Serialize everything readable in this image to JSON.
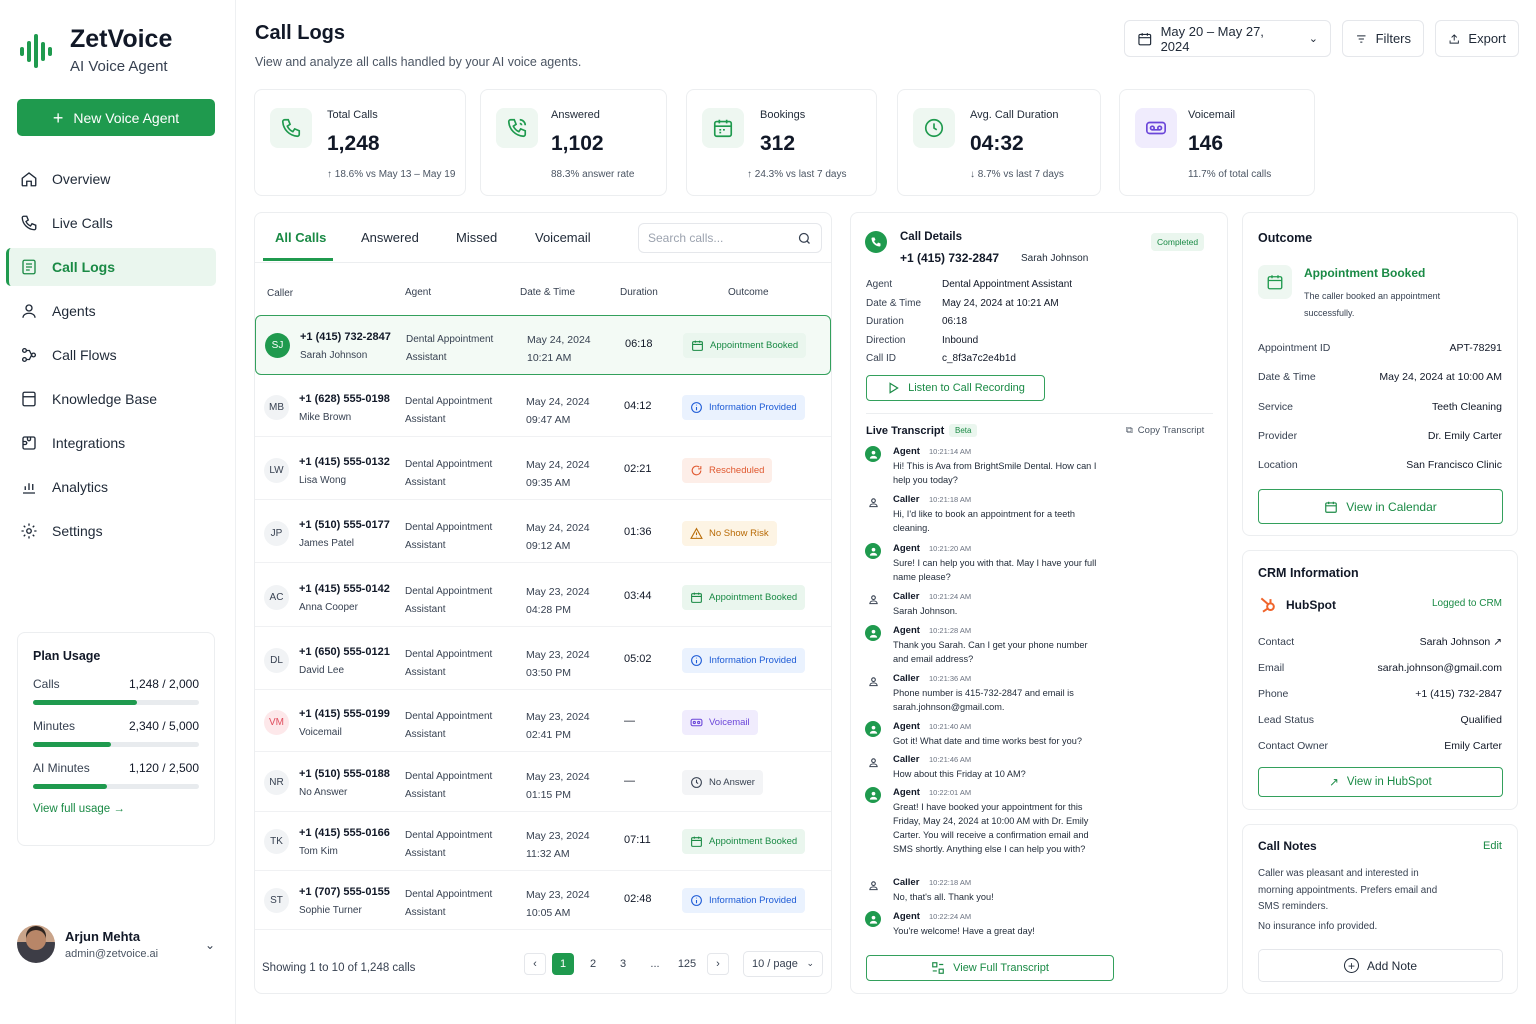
{
  "brand": {
    "name": "ZetVoice",
    "tagline": "AI Voice Agent"
  },
  "sidebar": {
    "new_agent_label": "New Voice Agent",
    "items": [
      {
        "label": "Overview",
        "icon": "home-icon"
      },
      {
        "label": "Live Calls",
        "icon": "phone-icon"
      },
      {
        "label": "Call Logs",
        "icon": "call-log-icon",
        "active": true
      },
      {
        "label": "Agents",
        "icon": "users-icon"
      },
      {
        "label": "Call Flows",
        "icon": "flow-icon"
      },
      {
        "label": "Knowledge Base",
        "icon": "book-icon"
      },
      {
        "label": "Integrations",
        "icon": "puzzle-icon"
      },
      {
        "label": "Analytics",
        "icon": "chart-icon"
      },
      {
        "label": "Settings",
        "icon": "gear-icon"
      }
    ],
    "plan": {
      "title": "Plan Usage",
      "rows": [
        {
          "label": "Calls",
          "value": "1,248 / 2,000",
          "fraction": 0.624
        },
        {
          "label": "Minutes",
          "value": "2,340 / 5,000",
          "fraction": 0.468
        },
        {
          "label": "AI Minutes",
          "value": "1,120 / 2,500",
          "fraction": 0.448
        }
      ],
      "link": "View full usage"
    },
    "user": {
      "name": "Arjun Mehta",
      "email": "admin@zetvoice.ai"
    }
  },
  "header": {
    "title": "Call Logs",
    "subtitle": "View and analyze all calls handled by your AI voice agents.",
    "date_range": "May 20 – May 27, 2024",
    "filters": "Filters",
    "export": "Export"
  },
  "stats": [
    {
      "label": "Total Calls",
      "value": "1,248",
      "sub": "↑ 18.6% vs May 13 – May 19"
    },
    {
      "label": "Answered",
      "value": "1,102",
      "sub": "88.3% answer rate"
    },
    {
      "label": "Bookings",
      "value": "312",
      "sub": "↑ 24.3% vs last 7 days"
    },
    {
      "label": "Avg. Call Duration",
      "value": "04:32",
      "sub": "↓ 8.7% vs last 7 days"
    },
    {
      "label": "Voicemail",
      "value": "146",
      "sub": "11.7% of total calls"
    }
  ],
  "calls": {
    "tabs": [
      "All Calls",
      "Answered",
      "Missed",
      "Voicemail"
    ],
    "search_placeholder": "Search calls...",
    "columns": [
      "Caller",
      "Agent",
      "Date & Time",
      "Duration",
      "Outcome"
    ],
    "rows": [
      {
        "initials": "SJ",
        "number": "+1 (415) 732-2847",
        "name": "Sarah Johnson",
        "agent1": "Dental Appointment",
        "agent2": "Assistant",
        "date": "May 24, 2024",
        "time": "10:21 AM",
        "duration": "06:18",
        "outcome": "Appointment Booked",
        "kind": "booked"
      },
      {
        "initials": "MB",
        "number": "+1 (628) 555-0198",
        "name": "Mike Brown",
        "agent1": "Dental Appointment",
        "agent2": "Assistant",
        "date": "May 24, 2024",
        "time": "09:47 AM",
        "duration": "04:12",
        "outcome": "Information Provided",
        "kind": "info"
      },
      {
        "initials": "LW",
        "number": "+1 (415) 555-0132",
        "name": "Lisa Wong",
        "agent1": "Dental Appointment",
        "agent2": "Assistant",
        "date": "May 24, 2024",
        "time": "09:35 AM",
        "duration": "02:21",
        "outcome": "Rescheduled",
        "kind": "resch"
      },
      {
        "initials": "JP",
        "number": "+1 (510) 555-0177",
        "name": "James Patel",
        "agent1": "Dental Appointment",
        "agent2": "Assistant",
        "date": "May 24, 2024",
        "time": "09:12 AM",
        "duration": "01:36",
        "outcome": "No Show Risk",
        "kind": "risk"
      },
      {
        "initials": "AC",
        "number": "+1 (415) 555-0142",
        "name": "Anna Cooper",
        "agent1": "Dental Appointment",
        "agent2": "Assistant",
        "date": "May 23, 2024",
        "time": "04:28 PM",
        "duration": "03:44",
        "outcome": "Appointment Booked",
        "kind": "booked"
      },
      {
        "initials": "DL",
        "number": "+1 (650) 555-0121",
        "name": "David Lee",
        "agent1": "Dental Appointment",
        "agent2": "Assistant",
        "date": "May 23, 2024",
        "time": "03:50 PM",
        "duration": "05:02",
        "outcome": "Information Provided",
        "kind": "info"
      },
      {
        "initials": "VM",
        "number": "+1 (415) 555-0199",
        "name": "Voicemail",
        "agent1": "Dental Appointment",
        "agent2": "Assistant",
        "date": "May 23, 2024",
        "time": "02:41 PM",
        "duration": "—",
        "outcome": "Voicemail",
        "kind": "vmail"
      },
      {
        "initials": "NR",
        "number": "+1 (510) 555-0188",
        "name": "No Answer",
        "agent1": "Dental Appointment",
        "agent2": "Assistant",
        "date": "May 23, 2024",
        "time": "01:15 PM",
        "duration": "—",
        "outcome": "No Answer",
        "kind": "noans"
      },
      {
        "initials": "TK",
        "number": "+1 (415) 555-0166",
        "name": "Tom Kim",
        "agent1": "Dental Appointment",
        "agent2": "Assistant",
        "date": "May 23, 2024",
        "time": "11:32 AM",
        "duration": "07:11",
        "outcome": "Appointment Booked",
        "kind": "booked"
      },
      {
        "initials": "ST",
        "number": "+1 (707) 555-0155",
        "name": "Sophie Turner",
        "agent1": "Dental Appointment",
        "agent2": "Assistant",
        "date": "May 23, 2024",
        "time": "10:05 AM",
        "duration": "02:48",
        "outcome": "Information Provided",
        "kind": "info"
      }
    ],
    "pagination": {
      "text": "Showing 1 to 10 of 1,248 calls",
      "pages": [
        "1",
        "2",
        "3",
        "...",
        "125"
      ],
      "per_page": "10 / page"
    }
  },
  "details": {
    "title": "Call Details",
    "status": "Completed",
    "number": "+1 (415) 732-2847",
    "name": "Sarah Johnson",
    "fields": [
      {
        "k": "Agent",
        "v": "Dental Appointment Assistant"
      },
      {
        "k": "Date & Time",
        "v": "May 24, 2024 at 10:21 AM"
      },
      {
        "k": "Duration",
        "v": "06:18"
      },
      {
        "k": "Direction",
        "v": "Inbound"
      },
      {
        "k": "Call ID",
        "v": "c_8f3a7c2e4b1d"
      }
    ],
    "listen": "Listen to Call Recording",
    "transcript_title": "Live Transcript",
    "beta": "Beta",
    "copy": "Copy Transcript",
    "messages": [
      {
        "who": "Agent",
        "time": "10:21:14 AM",
        "text": "Hi! This is Ava from BrightSmile Dental. How can I help you today?"
      },
      {
        "who": "Caller",
        "time": "10:21:18 AM",
        "text": "Hi, I'd like to book an appointment for a teeth cleaning."
      },
      {
        "who": "Agent",
        "time": "10:21:20 AM",
        "text": "Sure! I can help you with that. May I have your full name please?"
      },
      {
        "who": "Caller",
        "time": "10:21:24 AM",
        "text": "Sarah Johnson."
      },
      {
        "who": "Agent",
        "time": "10:21:28 AM",
        "text": "Thank you Sarah. Can I get your phone number and email address?"
      },
      {
        "who": "Caller",
        "time": "10:21:36 AM",
        "text": "Phone number is 415-732-2847 and email is sarah.johnson@gmail.com."
      },
      {
        "who": "Agent",
        "time": "10:21:40 AM",
        "text": "Got it! What date and time works best for you?"
      },
      {
        "who": "Caller",
        "time": "10:21:46 AM",
        "text": "How about this Friday at 10 AM?"
      },
      {
        "who": "Agent",
        "time": "10:22:01 AM",
        "text": "Great! I have booked your appointment for this Friday, May 24, 2024 at 10:00 AM with Dr. Emily Carter. You will receive a confirmation email and SMS shortly. Anything else I can help you with?"
      },
      {
        "who": "Caller",
        "time": "10:22:18 AM",
        "text": "No, that's all. Thank you!"
      },
      {
        "who": "Agent",
        "time": "10:22:24 AM",
        "text": "You're welcome! Have a great day!"
      }
    ],
    "full_transcript": "View Full Transcript"
  },
  "outcome": {
    "title": "Outcome",
    "status": "Appointment Booked",
    "desc": "The caller booked an appointment successfully.",
    "fields": [
      {
        "k": "Appointment ID",
        "v": "APT-78291"
      },
      {
        "k": "Date & Time",
        "v": "May 24, 2024 at 10:00 AM"
      },
      {
        "k": "Service",
        "v": "Teeth Cleaning"
      },
      {
        "k": "Provider",
        "v": "Dr. Emily Carter"
      },
      {
        "k": "Location",
        "v": "San Francisco Clinic"
      }
    ],
    "calendar_btn": "View in Calendar"
  },
  "crm": {
    "title": "CRM Information",
    "provider": "HubSpot",
    "logged": "Logged to CRM",
    "fields": [
      {
        "k": "Contact",
        "v": "Sarah Johnson"
      },
      {
        "k": "Email",
        "v": "sarah.johnson@gmail.com"
      },
      {
        "k": "Phone",
        "v": "+1 (415) 732-2847"
      },
      {
        "k": "Lead Status",
        "v": "Qualified"
      },
      {
        "k": "Contact Owner",
        "v": "Emily Carter"
      }
    ],
    "hubspot_btn": "View in HubSpot"
  },
  "notes": {
    "title": "Call Notes",
    "edit": "Edit",
    "text1": "Caller was pleasant and interested in morning appointments. Prefers email and SMS reminders.",
    "text2": "No insurance info provided.",
    "add": "Add Note"
  },
  "colors": {
    "accent": "#1f9a4e",
    "info": "#1d5bd6",
    "warning": "#e0582f"
  }
}
